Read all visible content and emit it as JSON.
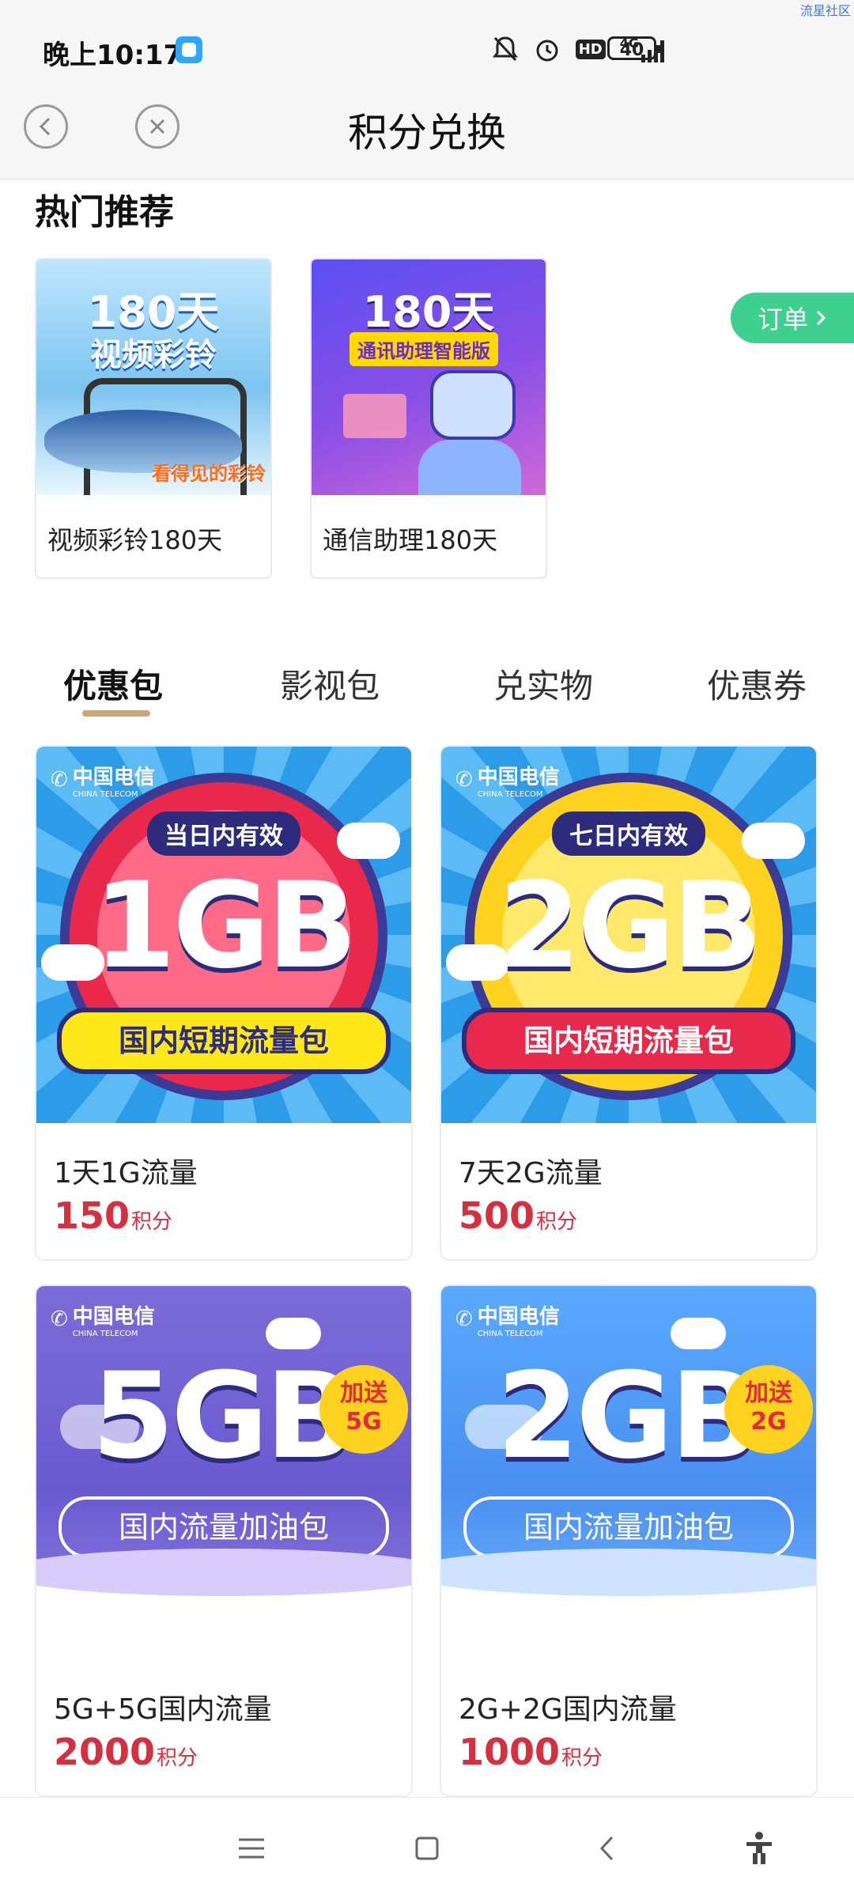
{
  "status": {
    "time": "晚上10:17",
    "network": "4G",
    "hd": "HD",
    "battery": "40",
    "watermark": "流星社区"
  },
  "header": {
    "title": "积分兑换"
  },
  "hot": {
    "title": "热门推荐",
    "order_label": "订单",
    "items": [
      {
        "name": "视频彩铃180天",
        "image_head": "180天",
        "image_sub": "视频彩铃",
        "image_slogan": "看得见的彩铃"
      },
      {
        "name": "通信助理180天",
        "image_head": "180天",
        "image_tag": "通讯助理智能版"
      }
    ]
  },
  "tabs": [
    "优惠包",
    "影视包",
    "兑实物",
    "优惠券"
  ],
  "products": [
    {
      "name": "1天1G流量",
      "price": "150",
      "unit": "积分",
      "validity": "当日内有效",
      "big": "1GB",
      "ribbon": "国内短期流量包",
      "brand": "中国电信",
      "brand_en": "CHINA TELECOM"
    },
    {
      "name": "7天2G流量",
      "price": "500",
      "unit": "积分",
      "validity": "七日内有效",
      "big": "2GB",
      "ribbon": "国内短期流量包",
      "brand": "中国电信",
      "brand_en": "CHINA TELECOM"
    },
    {
      "name": "5G+5G国内流量",
      "price": "2000",
      "unit": "积分",
      "big": "5GB",
      "bonus1": "加送",
      "bonus2": "5G",
      "ribbon": "国内流量加油包",
      "brand": "中国电信",
      "brand_en": "CHINA TELECOM"
    },
    {
      "name": "2G+2G国内流量",
      "price": "1000",
      "unit": "积分",
      "big": "2GB",
      "bonus1": "加送",
      "bonus2": "2G",
      "ribbon": "国内流量加油包",
      "brand": "中国电信",
      "brand_en": "CHINA TELECOM"
    }
  ],
  "icons": {
    "back": "chevron-left-icon",
    "close": "close-icon",
    "order_arrow": "chevron-right-icon",
    "nav": [
      "menu-icon",
      "home-square-icon",
      "back-arrow-icon",
      "accessibility-icon"
    ]
  },
  "colors": {
    "price": "#d62f3f",
    "order_button": "#3fcf8e",
    "tab_underline": "#c8a77a"
  }
}
